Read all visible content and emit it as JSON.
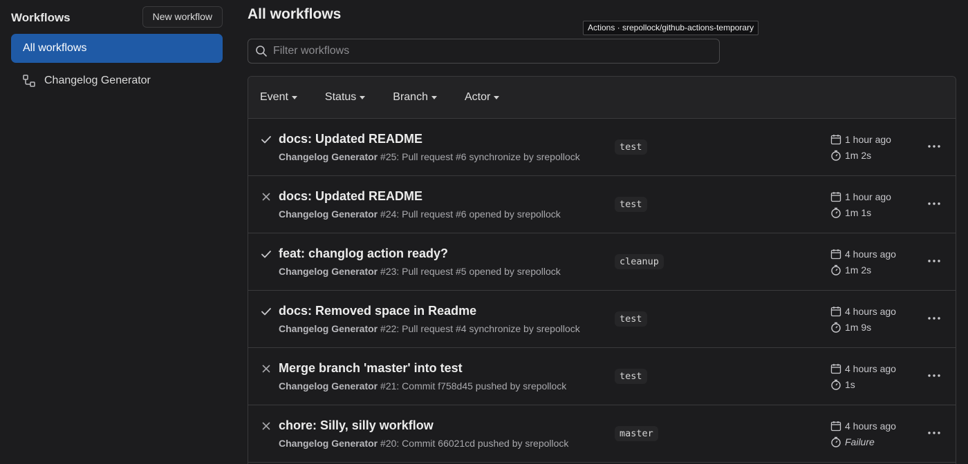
{
  "sidebar": {
    "title": "Workflows",
    "new_workflow_label": "New workflow",
    "all_workflows_label": "All workflows",
    "items": [
      {
        "label": "Changelog Generator",
        "icon": "workflow-icon"
      }
    ]
  },
  "main": {
    "title": "All workflows",
    "tooltip": "Actions · srepollock/github-actions-temporary",
    "filter_placeholder": "Filter workflows",
    "filters": [
      {
        "label": "Event"
      },
      {
        "label": "Status"
      },
      {
        "label": "Branch"
      },
      {
        "label": "Actor"
      }
    ],
    "runs": [
      {
        "status": "success",
        "title": "docs: Updated README",
        "workflow": "Changelog Generator",
        "detail_prefix": " #25: Pull request ",
        "ref": "#6",
        "detail_suffix": " synchronize by srepollock",
        "branch": "test",
        "time_ago": "1 hour ago",
        "duration": "1m 2s"
      },
      {
        "status": "failure",
        "title": "docs: Updated README",
        "workflow": "Changelog Generator",
        "detail_prefix": " #24: Pull request ",
        "ref": "#6",
        "detail_suffix": " opened by srepollock",
        "branch": "test",
        "time_ago": "1 hour ago",
        "duration": "1m 1s"
      },
      {
        "status": "success",
        "title": "feat: changlog action ready?",
        "workflow": "Changelog Generator",
        "detail_prefix": " #23: Pull request ",
        "ref": "#5",
        "detail_suffix": " opened by srepollock",
        "branch": "cleanup",
        "time_ago": "4 hours ago",
        "duration": "1m 2s"
      },
      {
        "status": "success",
        "title": "docs: Removed space in Readme",
        "workflow": "Changelog Generator",
        "detail_prefix": " #22: Pull request ",
        "ref": "#4",
        "detail_suffix": " synchronize by srepollock",
        "branch": "test",
        "time_ago": "4 hours ago",
        "duration": "1m 9s"
      },
      {
        "status": "failure",
        "title": "Merge branch 'master' into test",
        "workflow": "Changelog Generator",
        "detail_prefix": " #21: Commit ",
        "ref": "f758d45",
        "detail_suffix": " pushed by srepollock",
        "branch": "test",
        "time_ago": "4 hours ago",
        "duration": "1s"
      },
      {
        "status": "failure",
        "title": "chore: Silly, silly workflow",
        "workflow": "Changelog Generator",
        "detail_prefix": " #20: Commit ",
        "ref": "66021cd",
        "detail_suffix": " pushed by srepollock",
        "branch": "master",
        "time_ago": "4 hours ago",
        "duration": "Failure",
        "duration_italic": true
      }
    ]
  },
  "colors": {
    "background": "#1c1c1e",
    "accent": "#1f5aa6",
    "border": "#3a3a3c"
  }
}
